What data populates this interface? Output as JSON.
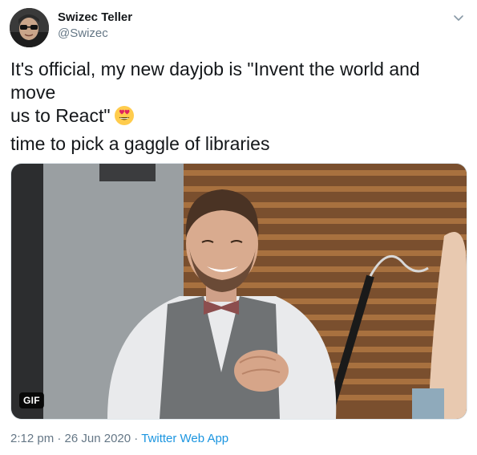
{
  "author": {
    "name": "Swizec Teller",
    "handle": "@Swizec"
  },
  "tweet": {
    "line1": "It's official, my new dayjob is \"Invent the world and move",
    "line2": "us to React\"",
    "emoji": "heart-eyes-emoji",
    "line3": "time to pick a gaggle of libraries"
  },
  "media": {
    "badge": "GIF"
  },
  "meta": {
    "time": "2:12 pm",
    "date": "26 Jun 2020",
    "separator": " · ",
    "app": "Twitter Web App"
  },
  "colors": {
    "link": "#1b95e0",
    "secondary": "#657786",
    "text": "#14171a"
  }
}
